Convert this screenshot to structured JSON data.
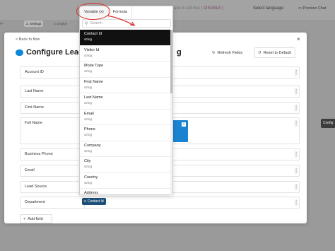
{
  "background": {
    "steps": [
      "2. Settings",
      "3. Deploy"
    ],
    "notice": "ace is still live |",
    "disable_label": "DISABLE |",
    "language_label": "Select language",
    "preview_label": "Preview Chat",
    "left_label": "ge",
    "configure_label": "Config"
  },
  "modal": {
    "back_label": "< Back to flow",
    "close_label": "×",
    "title": "Configure Leads",
    "title_tail": "g",
    "refresh_label": "Refresh Fields",
    "reset_label": "Reset to Default",
    "add_field_label": "Add field",
    "fields": [
      {
        "label": "Account ID"
      },
      {
        "label": "Last Name"
      },
      {
        "label": "First Name"
      },
      {
        "label": "Full Name"
      },
      {
        "label": "Business Phone"
      },
      {
        "label": "Email"
      },
      {
        "label": "Lead Source"
      },
      {
        "label": "Department"
      }
    ],
    "department_token": "Contact Id"
  },
  "popover": {
    "tabs": [
      "Variable (x)",
      "Formula"
    ],
    "search_placeholder": "Search",
    "items": [
      {
        "name": "Contact Id",
        "type": "string",
        "selected": true
      },
      {
        "name": "Visitor Id",
        "type": "string"
      },
      {
        "name": "Mode Type",
        "type": "string"
      },
      {
        "name": "First Name",
        "type": "string"
      },
      {
        "name": "Last Name",
        "type": "string"
      },
      {
        "name": "Email",
        "type": "string"
      },
      {
        "name": "Phone",
        "type": "string"
      },
      {
        "name": "Company",
        "type": "string"
      },
      {
        "name": "City",
        "type": "string"
      },
      {
        "name": "Country",
        "type": "string"
      },
      {
        "name": "Address",
        "type": ""
      }
    ]
  },
  "colors": {
    "accent": "#1d4f78",
    "selected": "#111111",
    "annotation": "#d9302a",
    "brand": "#0b86d8"
  }
}
